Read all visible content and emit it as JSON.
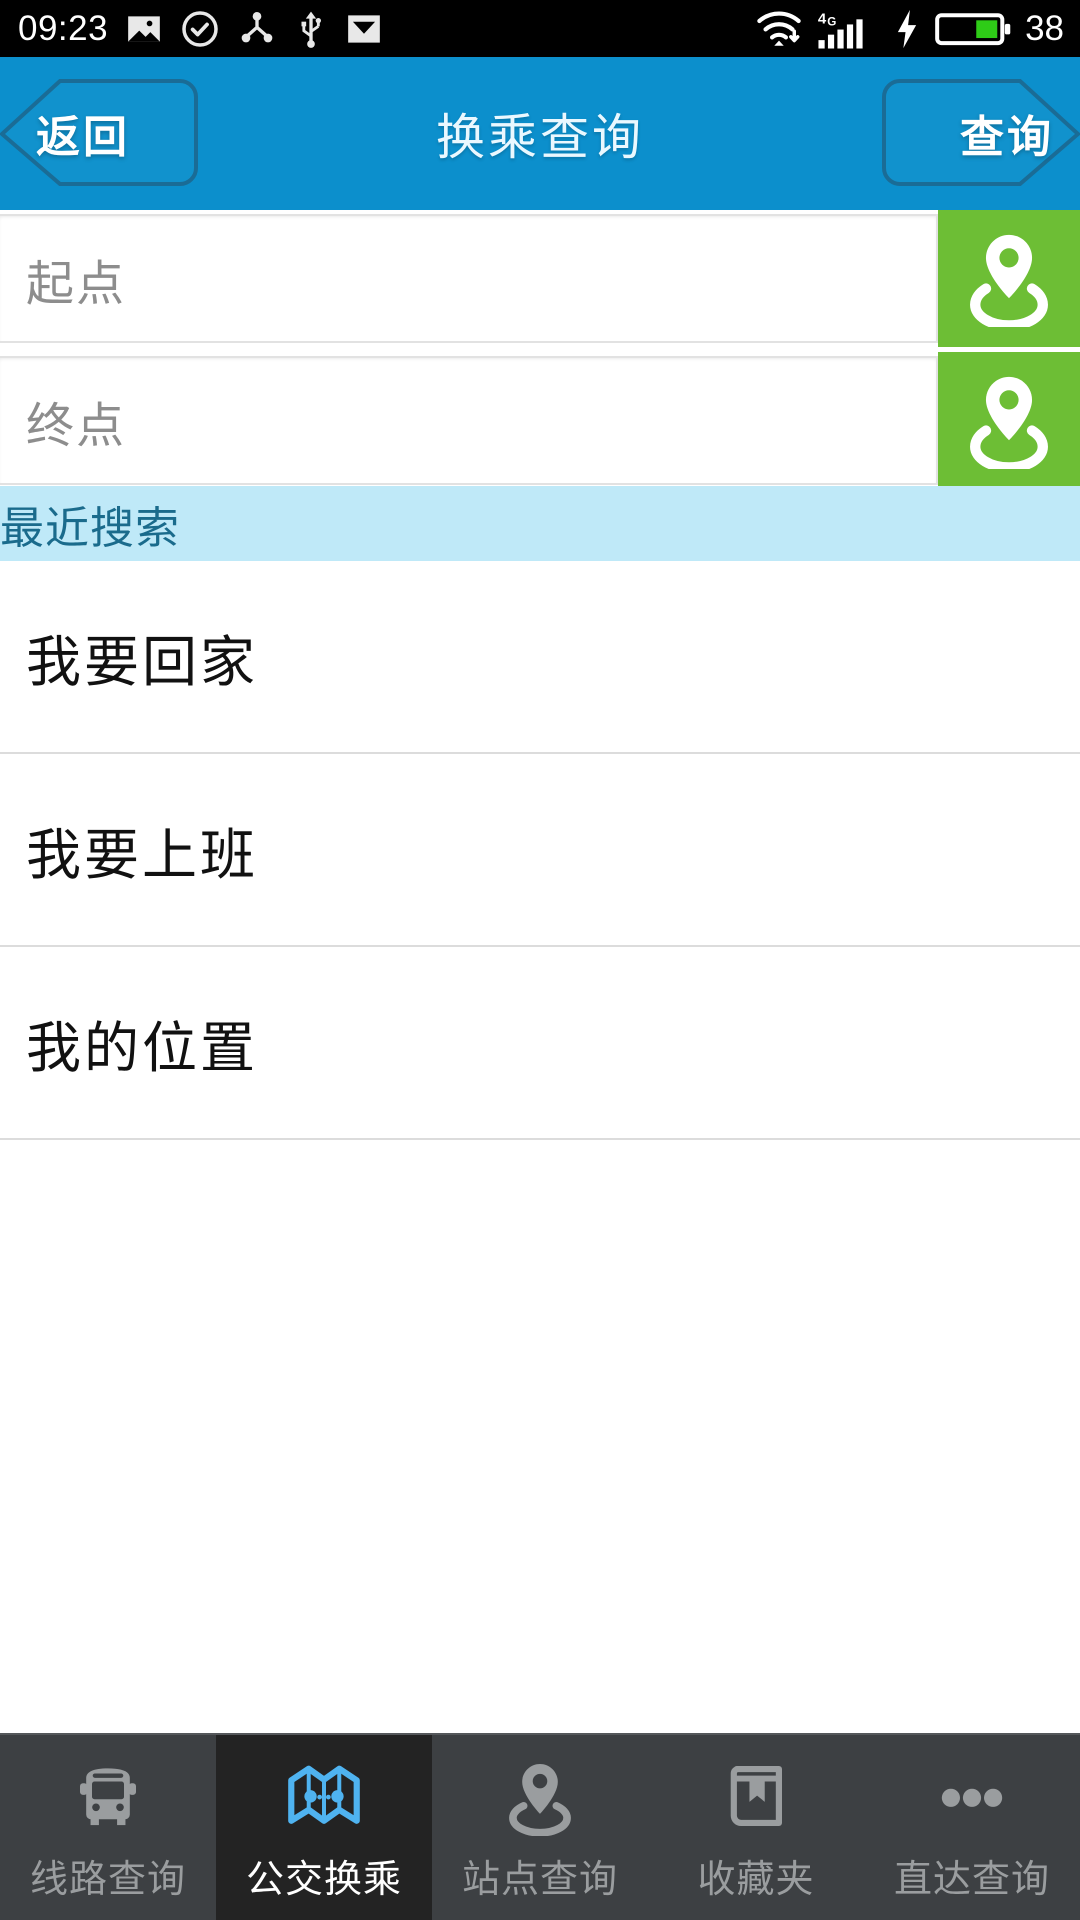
{
  "status_bar": {
    "time": "09:23",
    "battery_percent": "38",
    "network_type": "4G",
    "left_icons": [
      "image-icon",
      "check-circle-icon",
      "share-icon",
      "usb-icon",
      "mail-icon"
    ],
    "right_icons": [
      "wifi-download-icon",
      "signal-4g-icon",
      "charging-bolt-icon",
      "battery-icon"
    ]
  },
  "header": {
    "back_label": "返回",
    "title": "换乘查询",
    "action_label": "查询",
    "background_color": "#0c8fcc"
  },
  "search_form": {
    "origin": {
      "value": "",
      "placeholder": "起点",
      "locate_icon": "map-pin-icon"
    },
    "destination": {
      "value": "",
      "placeholder": "终点",
      "locate_icon": "map-pin-icon"
    },
    "locate_button_color": "#6dbe35"
  },
  "recent": {
    "section_title": "最近搜索",
    "section_bg_color": "#bfe9f8",
    "items": [
      {
        "label": "我要回家"
      },
      {
        "label": "我要上班"
      },
      {
        "label": "我的位置"
      }
    ]
  },
  "tabbar": {
    "active_color": "#4fb3f0",
    "items": [
      {
        "label": "线路查询",
        "icon": "bus-icon",
        "active": false
      },
      {
        "label": "公交换乘",
        "icon": "folded-map-icon",
        "active": true
      },
      {
        "label": "站点查询",
        "icon": "station-pin-icon",
        "active": false
      },
      {
        "label": "收藏夹",
        "icon": "bookmark-book-icon",
        "active": false
      },
      {
        "label": "直达查询",
        "icon": "more-dots-icon",
        "active": false
      }
    ]
  }
}
